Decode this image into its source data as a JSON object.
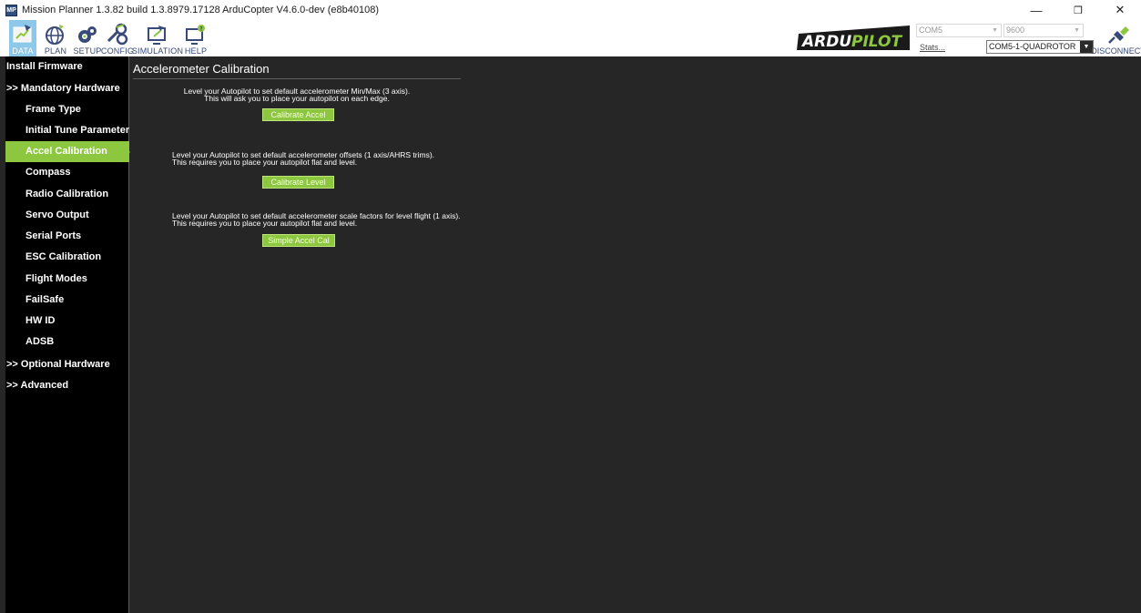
{
  "window": {
    "title": "Mission Planner 1.3.82 build 1.3.8979.17128 ArduCopter V4.6.0-dev (e8b40108)",
    "icon_text": "MP",
    "controls": {
      "minimize": "—",
      "maximize": "❐",
      "close": "✕"
    }
  },
  "toolbar": {
    "nav": [
      {
        "label": "DATA",
        "icon": "data-icon"
      },
      {
        "label": "PLAN",
        "icon": "globe-icon"
      },
      {
        "label": "SETUP",
        "icon": "gear-icon"
      },
      {
        "label": "CONFIG",
        "icon": "wrench-icon"
      },
      {
        "label": "SIMULATION",
        "icon": "simulation-icon"
      },
      {
        "label": "HELP",
        "icon": "help-icon"
      }
    ],
    "logo_text_1": "ARDU",
    "logo_text_2": "PILOT",
    "port": "COM5",
    "baud": "9600",
    "stats_link": "Stats...",
    "profile": "COM5-1-QUADROTOR",
    "disconnect_label": "DISCONNECT"
  },
  "sidebar": {
    "items": [
      {
        "label": "Install Firmware"
      },
      {
        "label": ">> Mandatory Hardware"
      },
      {
        "label": "Frame Type"
      },
      {
        "label": "Initial Tune Parameters"
      },
      {
        "label": "Accel Calibration"
      },
      {
        "label": "Compass"
      },
      {
        "label": "Radio Calibration"
      },
      {
        "label": "Servo Output"
      },
      {
        "label": "Serial Ports"
      },
      {
        "label": "ESC Calibration"
      },
      {
        "label": "Flight Modes"
      },
      {
        "label": "FailSafe"
      },
      {
        "label": "HW ID"
      },
      {
        "label": "ADSB"
      },
      {
        "label": ">> Optional Hardware"
      },
      {
        "label": ">> Advanced"
      }
    ]
  },
  "main": {
    "title": "Accelerometer Calibration",
    "sections": [
      {
        "line1": "Level your Autopilot to set default accelerometer Min/Max (3 axis).",
        "line2": "This will ask you to place your autopilot on each edge.",
        "button": "Calibrate Accel"
      },
      {
        "line1": "Level your Autopilot to set default accelerometer offsets (1 axis/AHRS trims).",
        "line2": "This requires you to place your autopilot flat and level.",
        "button": "Calibrate Level"
      },
      {
        "line1": "Level your Autopilot to set default accelerometer scale factors for level flight (1 axis).",
        "line2": "This requires you to place your autopilot flat and level.",
        "button": "Simple Accel Cal"
      }
    ]
  }
}
